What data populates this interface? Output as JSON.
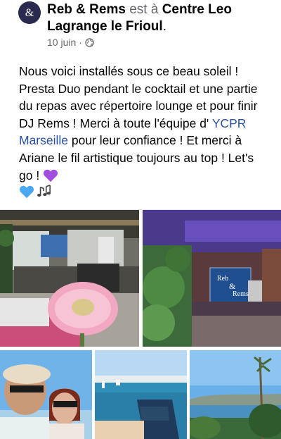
{
  "post": {
    "author": "Reb & Rems",
    "location_connector": "est à",
    "location": "Centre Leo Lagrange le Frioul",
    "location_trailing": ".",
    "date": "10 juin",
    "meta_separator": "·",
    "privacy_icon": "globe-icon",
    "text_part1": "Nous voici installés sous ce beau soleil ! Presta Duo pendant le cocktail et une partie du repas avec répertoire lounge et pour finir DJ Rems ! Merci à toute l'équipe d' ",
    "link_text": "YCPR Marseille",
    "text_part2": "  pour leur confiance ! Et merci à Ariane le fil artistique toujours au top ! Let's go ! ",
    "emojis": [
      "purple-heart",
      "blue-heart",
      "musical-notes"
    ]
  },
  "photos": {
    "banner_text_line1": "Reb",
    "banner_text_line2": "Rems",
    "banner_text_line3": "&"
  },
  "colors": {
    "text": "#050505",
    "muted": "#65676b",
    "link": "#2851a3",
    "purple_heart": "#a24de0",
    "blue_heart": "#4aa8f0"
  }
}
